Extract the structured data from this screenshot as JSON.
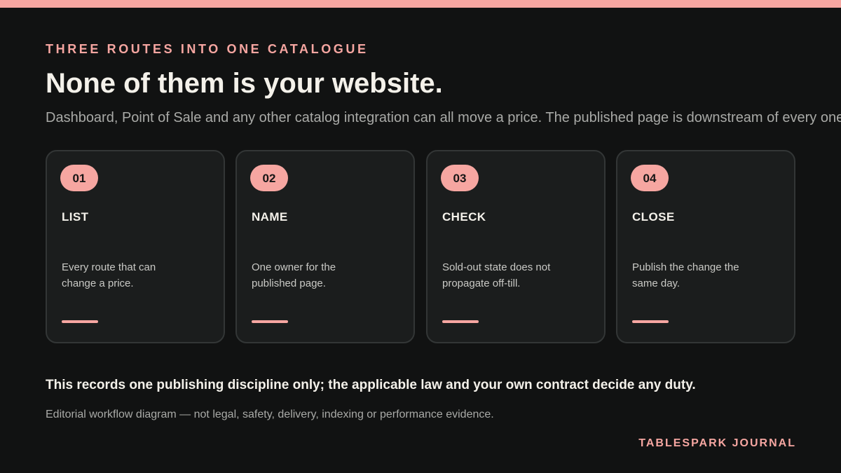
{
  "colors": {
    "background": "#111212",
    "accent": "#f6a6a1",
    "card_background": "#1b1d1d",
    "card_border": "#333636",
    "heading_text": "#f4f1ea",
    "muted_text": "#a9aaa7"
  },
  "header": {
    "eyebrow": "THREE ROUTES INTO ONE CATALOGUE",
    "title": "None of them is your website.",
    "subtitle": "Dashboard, Point of Sale and any other catalog integration can all move a price. The published page is downstream of every one."
  },
  "steps": [
    {
      "number": "01",
      "title": "LIST",
      "description": "Every route that can change a price."
    },
    {
      "number": "02",
      "title": "NAME",
      "description": "One owner for the published page."
    },
    {
      "number": "03",
      "title": "CHECK",
      "description": "Sold-out state does not propagate off-till."
    },
    {
      "number": "04",
      "title": "CLOSE",
      "description": "Publish the change the same day."
    }
  ],
  "footer": {
    "statement": "This records one publishing discipline only; the applicable law and your own contract decide any duty.",
    "disclaimer": "Editorial workflow diagram — not legal, safety, delivery, indexing or performance evidence.",
    "brand": "TABLESPARK JOURNAL"
  }
}
